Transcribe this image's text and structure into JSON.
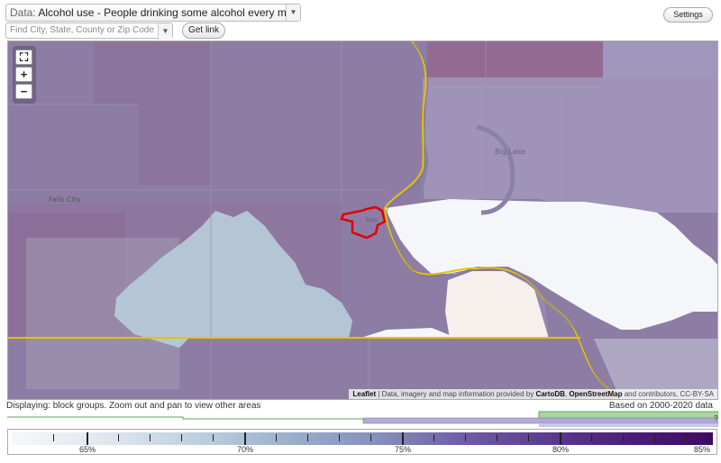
{
  "toolbar": {
    "data_prefix": "Data:",
    "data_value": "Alcohol use - People drinking some alcohol every month (%)",
    "search_placeholder": "Find City, State, County or Zip Code",
    "get_link_label": "Get link",
    "settings_label": "Settings"
  },
  "map": {
    "labels": {
      "falls_city": "Falls City",
      "big_lake": "Big Lake",
      "rulo": "Rulo"
    },
    "zoom": {
      "fullscreen_label": "⛶",
      "zoom_in_label": "+",
      "zoom_out_label": "−"
    },
    "attribution": {
      "leaflet": "Leaflet",
      "separator": " | Data, imagery and map information provided by ",
      "cartodb": "CartoDB",
      "comma": ", ",
      "osm": "OpenStreetMap",
      "rest": " and contributors, CC-BY-SA"
    },
    "colors": {
      "base": "#8d7da5",
      "dark_region": "#8e6d95",
      "light_region": "#f5f6f9",
      "blue_region": "#b6c9d9",
      "highlight": "#e00000",
      "boundary": "#e8c000"
    }
  },
  "status": {
    "displaying": "Displaying: block groups. Zoom out and pan to view other areas",
    "based_on": "Based on 2000-2020 data",
    "help": "?"
  },
  "legend": {
    "labels": [
      "65%",
      "70%",
      "75%",
      "80%",
      "85%"
    ],
    "colors": [
      "#f7f7f9",
      "#b9cddd",
      "#8590bc",
      "#5c3d8e",
      "#3f0a61"
    ]
  }
}
